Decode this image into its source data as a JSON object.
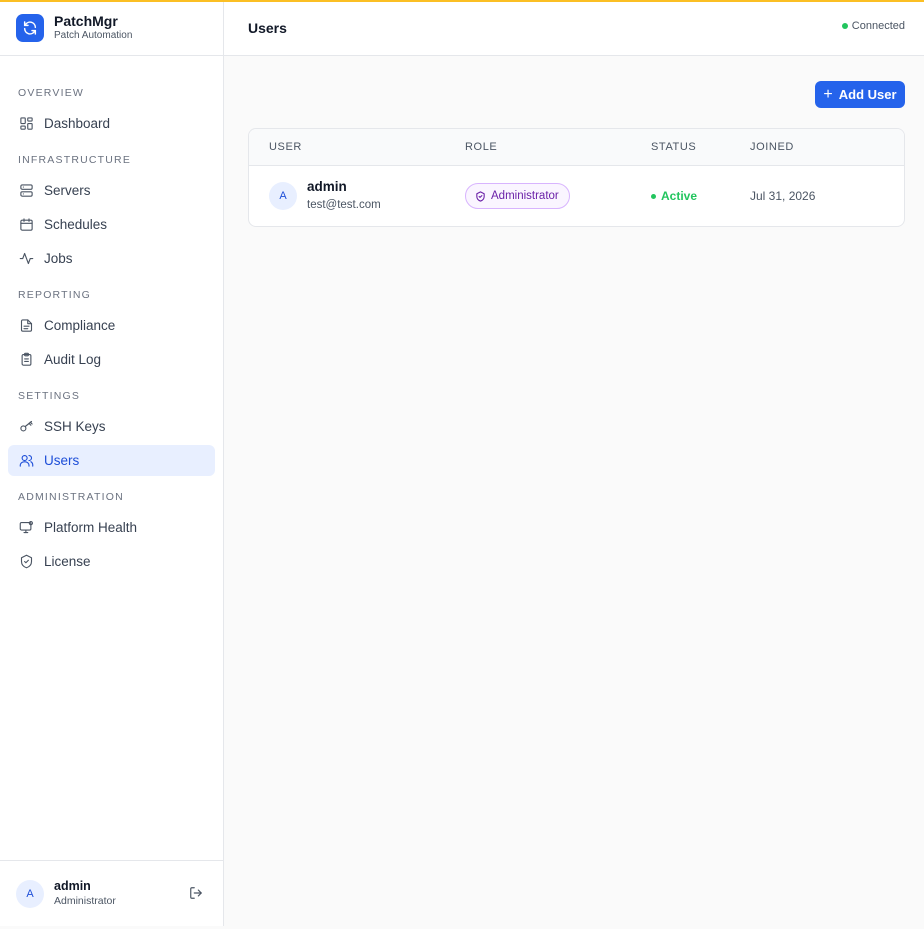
{
  "brand": {
    "name": "PatchMgr",
    "subtitle": "Patch Automation"
  },
  "sidebar": {
    "sections": [
      {
        "label": "OVERVIEW",
        "items": [
          {
            "label": "Dashboard",
            "icon": "dashboard-icon"
          }
        ]
      },
      {
        "label": "INFRASTRUCTURE",
        "items": [
          {
            "label": "Servers",
            "icon": "server-icon"
          },
          {
            "label": "Schedules",
            "icon": "calendar-icon"
          },
          {
            "label": "Jobs",
            "icon": "activity-icon"
          }
        ]
      },
      {
        "label": "REPORTING",
        "items": [
          {
            "label": "Compliance",
            "icon": "document-icon"
          },
          {
            "label": "Audit Log",
            "icon": "clipboard-icon"
          }
        ]
      },
      {
        "label": "SETTINGS",
        "items": [
          {
            "label": "SSH Keys",
            "icon": "key-icon"
          },
          {
            "label": "Users",
            "icon": "users-icon",
            "active": true
          }
        ]
      },
      {
        "label": "ADMINISTRATION",
        "items": [
          {
            "label": "Platform Health",
            "icon": "monitor-icon"
          },
          {
            "label": "License",
            "icon": "shield-check-icon"
          }
        ]
      }
    ],
    "footer": {
      "avatar": "A",
      "name": "admin",
      "role": "Administrator"
    }
  },
  "header": {
    "title": "Users",
    "connection": "Connected"
  },
  "toolbar": {
    "add_user_label": "Add User"
  },
  "table": {
    "columns": [
      "USER",
      "ROLE",
      "STATUS",
      "JOINED"
    ],
    "rows": [
      {
        "avatar": "A",
        "name": "admin",
        "email": "test@test.com",
        "role": "Administrator",
        "status": "Active",
        "joined": "Jul 31, 2026"
      }
    ]
  },
  "colors": {
    "accent": "#2563eb",
    "success": "#22c55e",
    "role_badge": "#6b21a8",
    "top_border": "#fbbf24"
  }
}
